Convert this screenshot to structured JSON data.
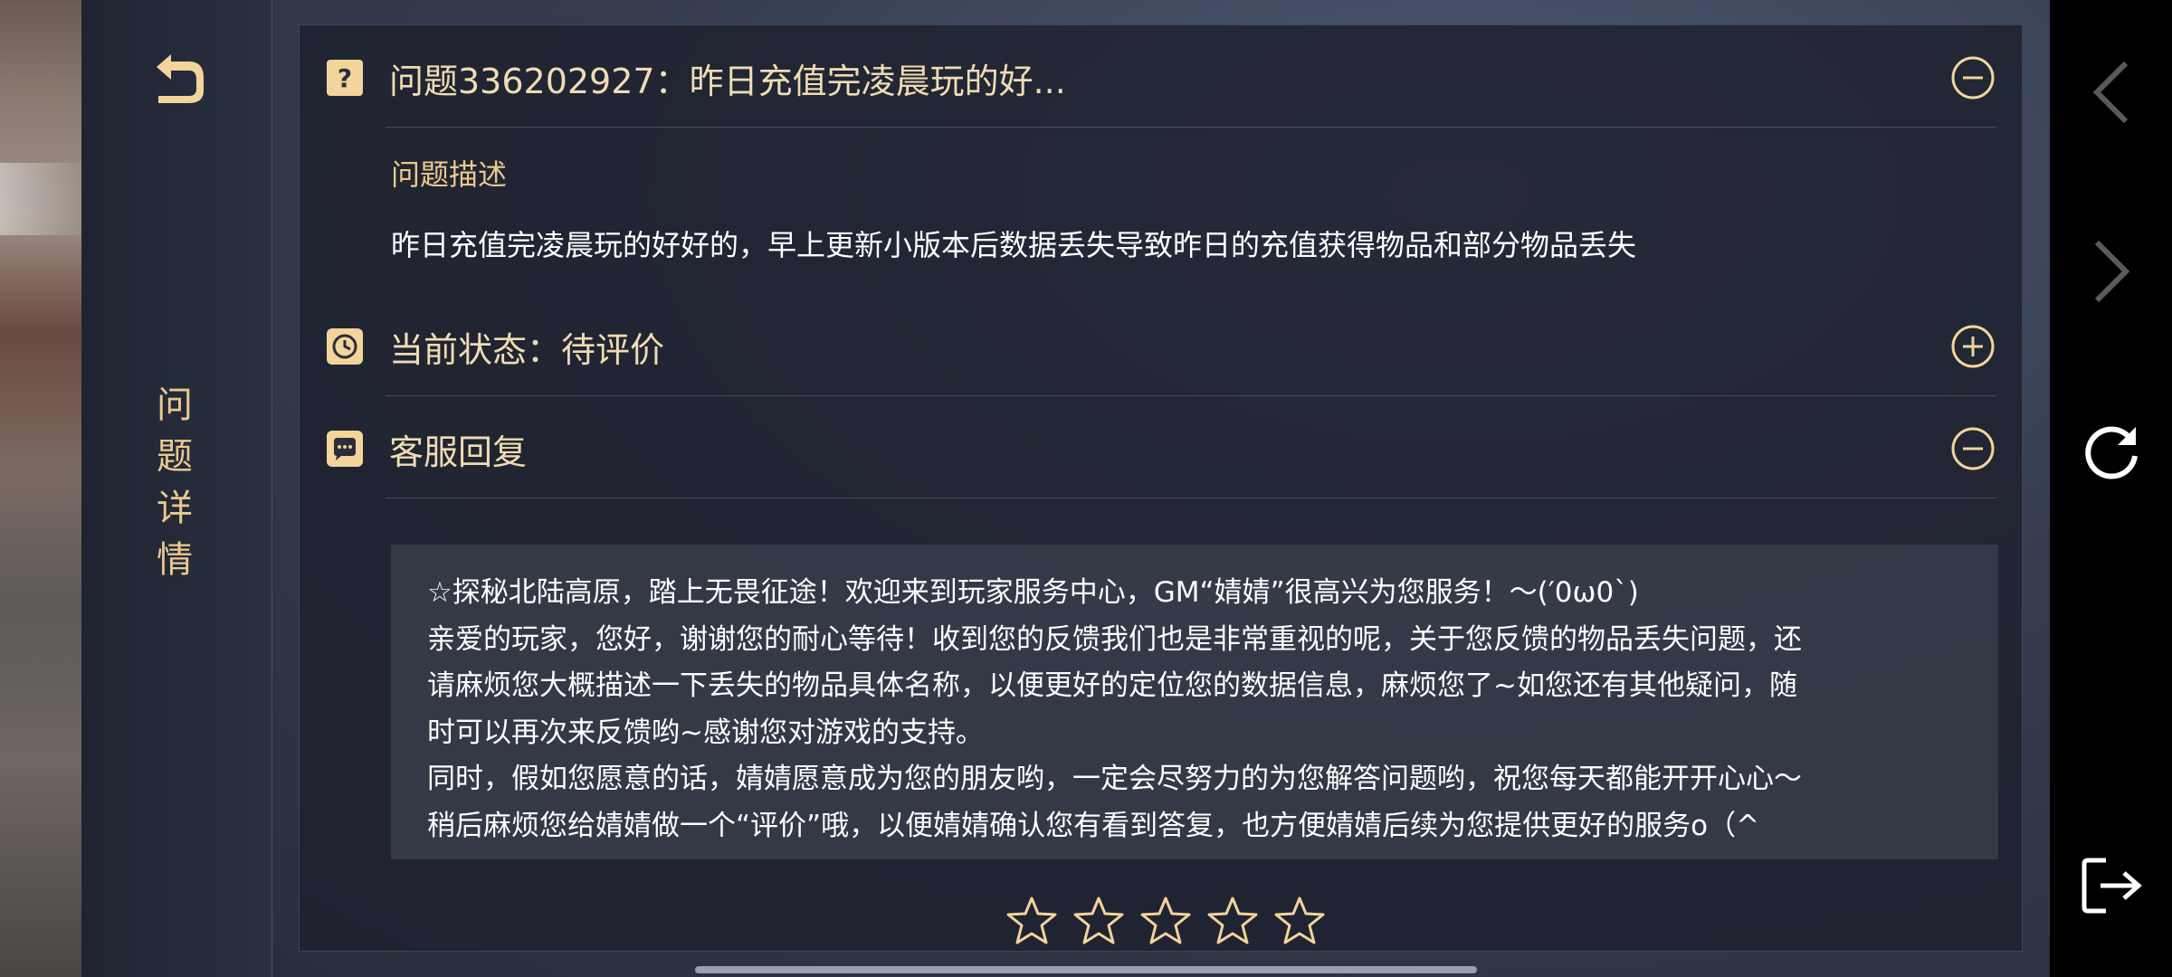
{
  "side": {
    "back_icon": "return-arrow-icon",
    "title_chars": [
      "问",
      "题",
      "详",
      "情"
    ]
  },
  "question": {
    "icon": "question-mark-icon",
    "title": "问题336202927：昨日充值完凌晨玩的好...",
    "toggle_icon": "collapse-minus-icon",
    "desc_label": "问题描述",
    "desc_text": "昨日充值完凌晨玩的好好的，早上更新小版本后数据丢失导致昨日的充值获得物品和部分物品丢失"
  },
  "status": {
    "icon": "clock-icon",
    "label": "当前状态：待评价",
    "toggle_icon": "expand-plus-icon"
  },
  "reply": {
    "icon": "chat-bubble-icon",
    "label": "客服回复",
    "toggle_icon": "collapse-minus-icon",
    "lines": [
      "☆探秘北陆高原，踏上无畏征途！欢迎来到玩家服务中心，GM“婧婧”很高兴为您服务！～(′0ω0`)",
      "亲爱的玩家，您好，谢谢您的耐心等待！收到您的反馈我们也是非常重视的呢，关于您反馈的物品丢失问题，还",
      "请麻烦您大概描述一下丢失的物品具体名称，以便更好的定位您的数据信息，麻烦您了~如您还有其他疑问，随",
      "时可以再次来反馈哟~感谢您对游戏的支持。",
      "同时，假如您愿意的话，婧婧愿意成为您的朋友哟，一定会尽努力的为您解答问题哟，祝您每天都能开开心心～",
      "稍后麻烦您给婧婧做一个“评价”哦，以便婧婧确认您有看到答复，也方便婧婧后续为您提供更好的服务o（^"
    ]
  },
  "rating": {
    "max_stars": 5,
    "selected": 0,
    "star_icon": "star-outline-icon"
  },
  "system_nav": {
    "items": [
      "back-chevron-icon",
      "forward-chevron-icon",
      "refresh-icon",
      "exit-icon"
    ]
  },
  "colors": {
    "accent_gold": "#e9c98f",
    "title_text": "#f0dcb4",
    "body_text": "#ffffff",
    "panel_bg": "#1e222e"
  }
}
